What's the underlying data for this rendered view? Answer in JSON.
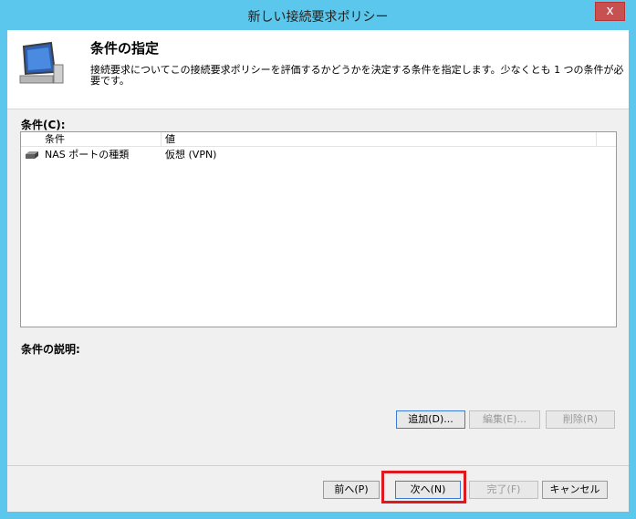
{
  "window": {
    "title": "新しい接続要求ポリシー",
    "close_label": "x"
  },
  "header": {
    "title": "条件の指定",
    "description": "接続要求についてこの接続要求ポリシーを評価するかどうかを決定する条件を指定します。少なくとも 1 つの条件が必要です。"
  },
  "conditions": {
    "label": "条件(C):",
    "columns": [
      "条件",
      "値"
    ],
    "rows": [
      {
        "condition": "NAS ポートの種類",
        "value": "仮想 (VPN)"
      }
    ]
  },
  "description_label": "条件の説明:",
  "actions": {
    "add": "追加(D)...",
    "edit": "編集(E)...",
    "delete": "削除(R)"
  },
  "nav": {
    "back": "前へ(P)",
    "next": "次へ(N)",
    "finish": "完了(F)",
    "cancel": "キャンセル"
  },
  "colors": {
    "frame": "#5cc7ec",
    "highlight": "#e0191f"
  },
  "icons": [
    "monitor-icon",
    "nas-port-icon",
    "close-icon"
  ]
}
